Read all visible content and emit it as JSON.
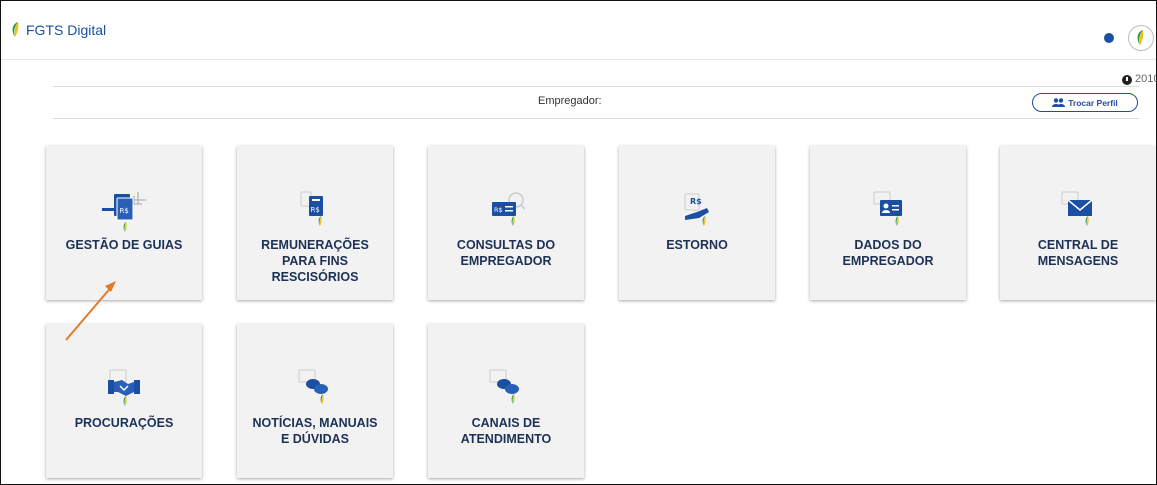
{
  "header": {
    "app_title": "FGTS Digital"
  },
  "session": {
    "time": "2010",
    "employer_label": "Empregador:",
    "switch_profile": "Trocar Perfil"
  },
  "cards": [
    {
      "label": "GESTÃO DE GUIAS",
      "icon": "guides-money-icon"
    },
    {
      "label": "REMUNERAÇÕES\nPARA FINS\nRESCISÓRIOS",
      "icon": "remuneration-doc-icon"
    },
    {
      "label": "CONSULTAS DO\nEMPREGADOR",
      "icon": "money-search-icon"
    },
    {
      "label": "ESTORNO",
      "icon": "refund-hand-icon"
    },
    {
      "label": "DADOS DO\nEMPREGADOR",
      "icon": "id-card-icon"
    },
    {
      "label": "CENTRAL DE\nMENSAGENS",
      "icon": "envelope-icon"
    },
    {
      "label": "PROCURAÇÕES",
      "icon": "handshake-icon"
    },
    {
      "label": "NOTÍCIAS, MANUAIS\nE DÚVIDAS",
      "icon": "chat-bubbles-icon"
    },
    {
      "label": "CANAIS DE\nATENDIMENTO",
      "icon": "chat-bubbles-icon"
    }
  ],
  "colors": {
    "primary": "#1a4fa3",
    "card_bg": "#f2f2f2",
    "label": "#1d3157",
    "arrow": "#e07b2a",
    "leaf_green": "#2e9a3e",
    "leaf_yellow": "#f2c01a"
  }
}
